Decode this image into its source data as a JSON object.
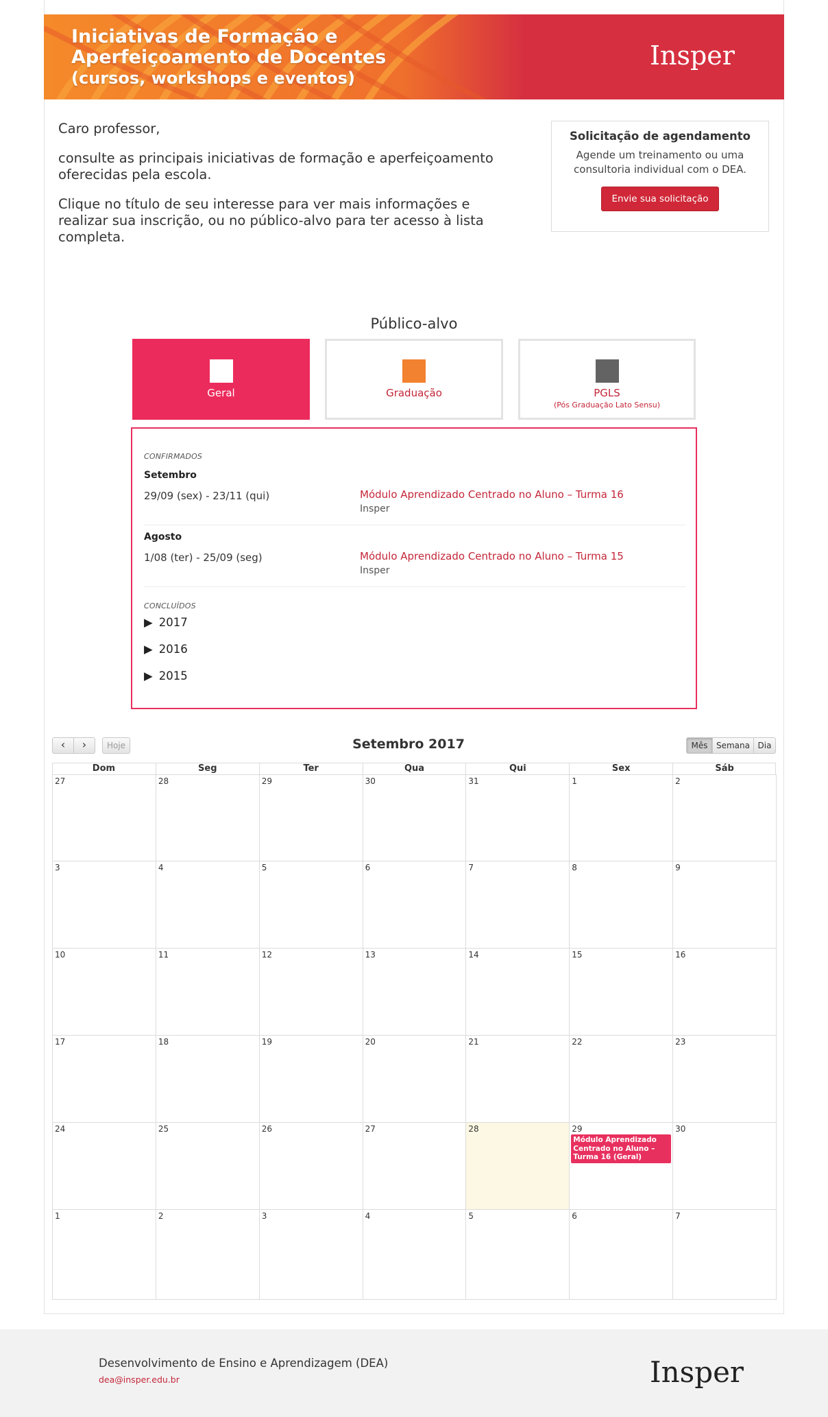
{
  "banner": {
    "title_line1": "Iniciativas de Formação e",
    "title_line2": "Aperfeiçoamento de Docentes",
    "title_line3": "(cursos, workshops e eventos)",
    "logo": "Insper"
  },
  "intro": {
    "greeting": "Caro professor,",
    "para1": "consulte as principais iniciativas de formação e aperfeiçoamento oferecidas pela escola.",
    "para2": "Clique no título de seu interesse para ver mais informações e realizar sua inscrição, ou no público-alvo para ter acesso à lista completa."
  },
  "scheduling": {
    "title": "Solicitação de agendamento",
    "text": "Agende um treinamento ou uma consultoria individual com o DEA.",
    "button": "Envie sua solicitação"
  },
  "audience": {
    "title": "Público-alvo",
    "items": [
      {
        "label": "Geral",
        "sublabel": "",
        "color": "#ec2b5d"
      },
      {
        "label": "Graduação",
        "sublabel": "",
        "color": "#f28130"
      },
      {
        "label": "PGLS",
        "sublabel": "(Pós Graduação Lato Sensu)",
        "color": "#636363"
      }
    ]
  },
  "events": {
    "confirmed_label": "CONFIRMADOS",
    "groups": [
      {
        "month": "Setembro",
        "date": "29/09 (sex) - 23/11 (qui)",
        "title": "Módulo Aprendizado Centrado no Aluno – Turma 16",
        "org": "Insper"
      },
      {
        "month": "Agosto",
        "date": "1/08 (ter) - 25/09 (seg)",
        "title": "Módulo Aprendizado Centrado no Aluno – Turma 15",
        "org": "Insper"
      }
    ],
    "concluded_label": "CONCLUÍDOS",
    "years": [
      "2017",
      "2016",
      "2015"
    ],
    "expand_icon": "▶"
  },
  "calendar": {
    "title": "Setembro 2017",
    "prev": "‹",
    "next": "›",
    "today": "Hoje",
    "views": [
      "Mês",
      "Semana",
      "Dia"
    ],
    "active_view": "Mês",
    "weekdays": [
      "Dom",
      "Seg",
      "Ter",
      "Qua",
      "Qui",
      "Sex",
      "Sáb"
    ],
    "weeks": [
      [
        "27",
        "28",
        "29",
        "30",
        "31",
        "1",
        "2"
      ],
      [
        "3",
        "4",
        "5",
        "6",
        "7",
        "8",
        "9"
      ],
      [
        "10",
        "11",
        "12",
        "13",
        "14",
        "15",
        "16"
      ],
      [
        "17",
        "18",
        "19",
        "20",
        "21",
        "22",
        "23"
      ],
      [
        "24",
        "25",
        "26",
        "27",
        "28",
        "29",
        "30"
      ],
      [
        "1",
        "2",
        "3",
        "4",
        "5",
        "6",
        "7"
      ]
    ],
    "today_cell": "28",
    "event": {
      "text": "Módulo Aprendizado Centrado no Aluno – Turma 16 (Geral)",
      "day": "29",
      "color": "#e8305f"
    },
    "today_color": "#fcf8e3"
  },
  "footer": {
    "department": "Desenvolvimento de Ensino e Aprendizagem (DEA)",
    "email": "dea@insper.edu.br",
    "logo": "Insper"
  }
}
